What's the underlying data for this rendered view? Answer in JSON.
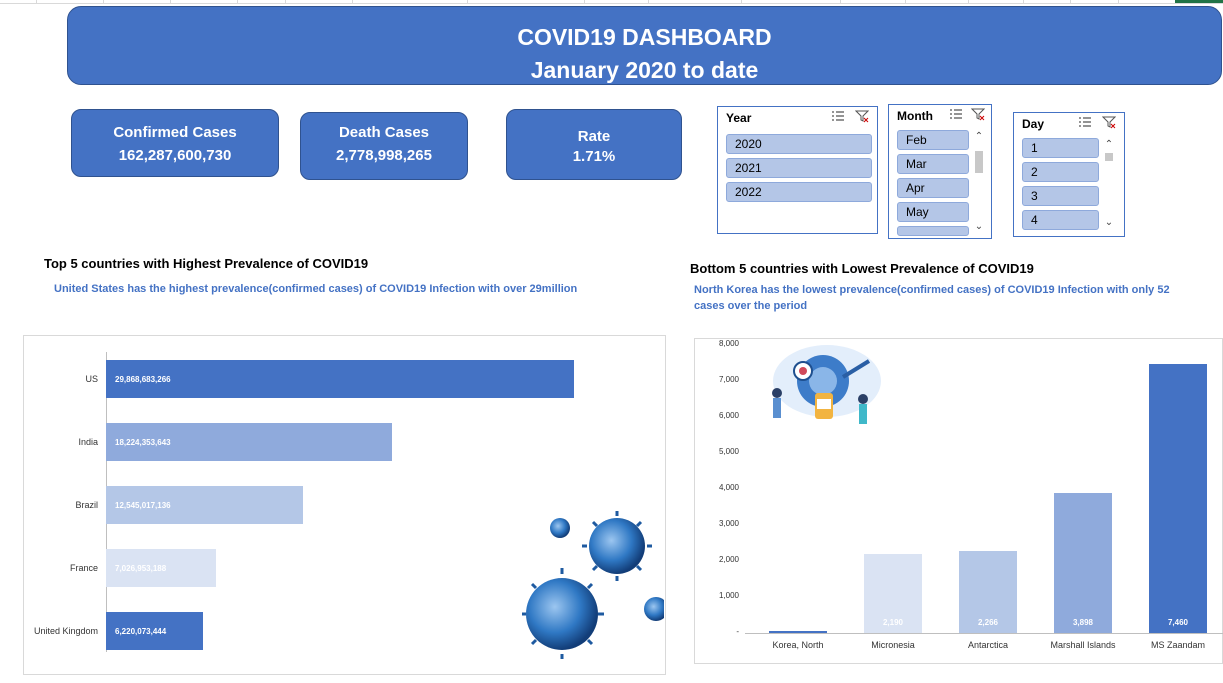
{
  "title": {
    "line1": "COVID19 DASHBOARD",
    "line2": "January 2020 to date"
  },
  "kpis": [
    {
      "label": "Confirmed Cases",
      "value": "162,287,600,730"
    },
    {
      "label": "Death Cases",
      "value": "2,778,998,265"
    },
    {
      "label": "Rate",
      "value": "1.71%"
    }
  ],
  "slicers": {
    "year": {
      "title": "Year",
      "items": [
        "2020",
        "2021",
        "2022"
      ]
    },
    "month": {
      "title": "Month",
      "items": [
        "Feb",
        "Mar",
        "Apr",
        "May"
      ]
    },
    "day": {
      "title": "Day",
      "items": [
        "1",
        "2",
        "3",
        "4"
      ]
    }
  },
  "top5": {
    "heading": "Top 5  countries with Highest Prevalence of COVID19",
    "note": "United States has the highest prevalence(confirmed cases) of COVID19 Infection  with over 29million"
  },
  "bottom5": {
    "heading": "Bottom 5  countries with Lowest Prevalence of COVID19",
    "note_line1": "North Korea has the lowest prevalence(confirmed cases) of COVID19 Infection  with only 52",
    "note_line2": "cases over the period"
  },
  "chart_data": [
    {
      "type": "bar",
      "orientation": "horizontal",
      "categories": [
        "US",
        "India",
        "Brazil",
        "France",
        "United Kingdom"
      ],
      "values": [
        29868683266,
        18224353643,
        12545017136,
        7026953188,
        6220073444
      ],
      "labels": [
        "29,868,683,266",
        "18,224,353,643",
        "12,545,017,136",
        "7,026,953,188",
        "6,220,073,444"
      ],
      "colors": [
        "#4472c4",
        "#8faadc",
        "#b4c7e7",
        "#dae3f3",
        "#4472c4"
      ]
    },
    {
      "type": "bar",
      "orientation": "vertical",
      "categories": [
        "Korea, North",
        "Micronesia",
        "Antarctica",
        "Marshall Islands",
        "MS Zaandam"
      ],
      "values": [
        52,
        2190,
        2266,
        3898,
        7460
      ],
      "labels": [
        "",
        "2,190",
        "2,266",
        "3,898",
        "7,460"
      ],
      "yticks": [
        "8,000",
        "7,000",
        "6,000",
        "5,000",
        "4,000",
        "3,000",
        "2,000",
        "1,000",
        "-"
      ],
      "ylim": [
        0,
        8000
      ],
      "colors": [
        "#4472c4",
        "#dae3f3",
        "#b4c7e7",
        "#8faadc",
        "#4472c4"
      ]
    }
  ]
}
